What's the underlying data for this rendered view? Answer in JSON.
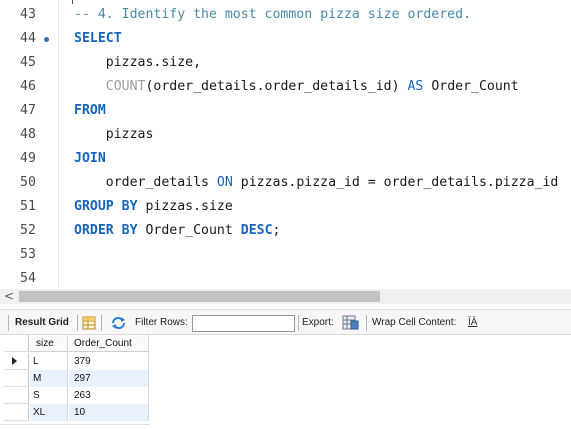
{
  "editor": {
    "lines": [
      {
        "num": "43",
        "breakpoint": false,
        "tokens": [
          {
            "cls": "cm",
            "text": "-- 4. Identify the most common pizza size ordered."
          }
        ]
      },
      {
        "num": "44",
        "breakpoint": true,
        "tokens": [
          {
            "cls": "kw",
            "text": "SELECT"
          }
        ]
      },
      {
        "num": "45",
        "breakpoint": false,
        "tokens": [
          {
            "cls": "tx",
            "text": "    pizzas.size,"
          }
        ]
      },
      {
        "num": "46",
        "breakpoint": false,
        "tokens": [
          {
            "cls": "tx",
            "text": "    "
          },
          {
            "cls": "fn",
            "text": "COUNT"
          },
          {
            "cls": "tx",
            "text": "(order_details.order_details_id) "
          },
          {
            "cls": "kw2",
            "text": "AS"
          },
          {
            "cls": "tx",
            "text": " Order_Count"
          }
        ]
      },
      {
        "num": "47",
        "breakpoint": false,
        "tokens": [
          {
            "cls": "kw",
            "text": "FROM"
          }
        ]
      },
      {
        "num": "48",
        "breakpoint": false,
        "tokens": [
          {
            "cls": "tx",
            "text": "    pizzas"
          }
        ]
      },
      {
        "num": "49",
        "breakpoint": false,
        "tokens": [
          {
            "cls": "kw",
            "text": "JOIN"
          }
        ]
      },
      {
        "num": "50",
        "breakpoint": false,
        "tokens": [
          {
            "cls": "tx",
            "text": "    order_details "
          },
          {
            "cls": "kw2",
            "text": "ON"
          },
          {
            "cls": "tx",
            "text": " pizzas.pizza_id = order_details.pizza_id"
          }
        ]
      },
      {
        "num": "51",
        "breakpoint": false,
        "tokens": [
          {
            "cls": "kw",
            "text": "GROUP BY"
          },
          {
            "cls": "tx",
            "text": " pizzas.size"
          }
        ]
      },
      {
        "num": "52",
        "breakpoint": false,
        "tokens": [
          {
            "cls": "kw",
            "text": "ORDER BY"
          },
          {
            "cls": "tx",
            "text": " Order_Count "
          },
          {
            "cls": "kw",
            "text": "DESC"
          },
          {
            "cls": "tx",
            "text": ";"
          }
        ]
      },
      {
        "num": "53",
        "breakpoint": false,
        "tokens": []
      },
      {
        "num": "54",
        "breakpoint": false,
        "tokens": []
      }
    ]
  },
  "scrollbar": {
    "left_arrow": "<"
  },
  "toolbar": {
    "result_grid_label": "Result Grid",
    "filter_rows_label": "Filter Rows:",
    "filter_rows_value": "",
    "export_label": "Export:",
    "wrap_cell_label": "Wrap Cell Content:",
    "wrap_icon_glyph": "ĪĀ"
  },
  "grid": {
    "columns": [
      "size",
      "Order_Count"
    ],
    "rows": [
      [
        "L",
        "379"
      ],
      [
        "M",
        "297"
      ],
      [
        "S",
        "263"
      ],
      [
        "XL",
        "10"
      ]
    ]
  },
  "colors": {
    "keyword": "#1565c0",
    "comment": "#4a8aa8",
    "function": "#9e9e9e",
    "alt_row": "#e9f1fb"
  }
}
